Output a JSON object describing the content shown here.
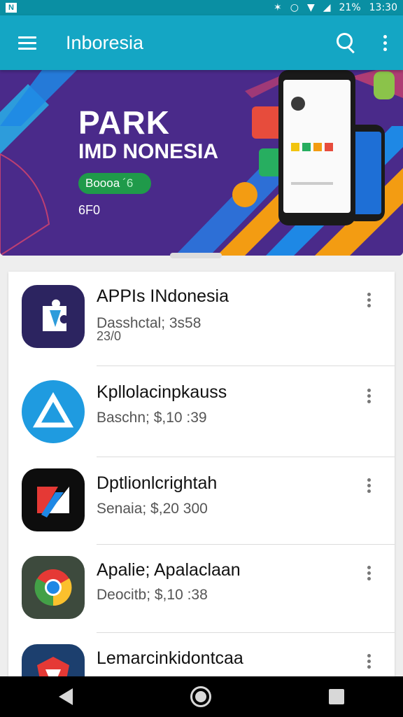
{
  "status_bar": {
    "notification_badge": "N",
    "battery": "21%",
    "time": "13:30"
  },
  "app_bar": {
    "title": "Inboresia"
  },
  "banner": {
    "headline1": "PARK",
    "headline2": "IMD NONESIA",
    "button_label": "Boooa",
    "button_suffix": "´6",
    "price": "6F0",
    "colors": {
      "background": "#4a2a8a",
      "accent_blue": "#1e88e5",
      "accent_orange": "#f39c12"
    }
  },
  "apps": [
    {
      "name": "APPIs INdonesia",
      "subtitle": "Dasshctal; 3s58",
      "subtitle2": "23/0",
      "icon": "puzzle-icon"
    },
    {
      "name": "Kpllolacinpkauss",
      "subtitle": "Baschn; $,10 :39",
      "subtitle2": "",
      "icon": "triangle-logo-icon"
    },
    {
      "name": "Dptlionlcrightah",
      "subtitle": "Senaia; $,20 300",
      "subtitle2": "",
      "icon": "slash-logo-icon"
    },
    {
      "name": "Apalie; Apalaclaan",
      "subtitle": "Deocitb; $,10 :38",
      "subtitle2": "",
      "icon": "chrome-icon"
    },
    {
      "name": "Lemarcinkidontcaa",
      "subtitle": "",
      "subtitle2": "",
      "icon": "shield-logo-icon"
    }
  ]
}
